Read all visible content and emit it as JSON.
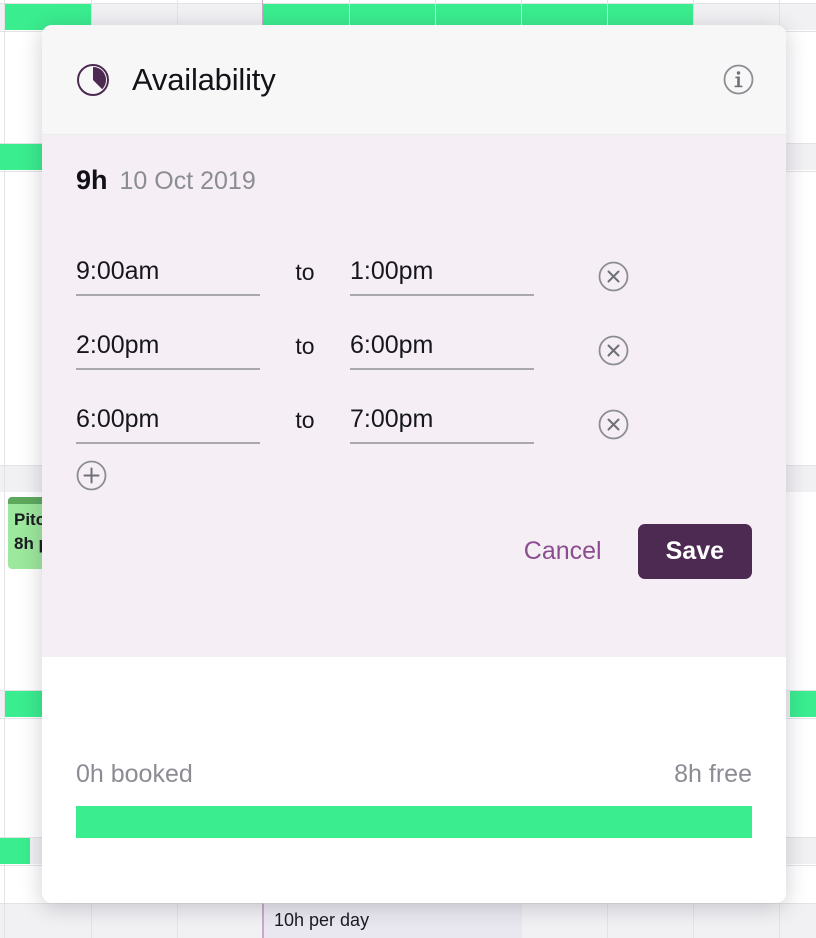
{
  "modal": {
    "title": "Availability",
    "icons": {
      "title_icon": "pie-chart-icon",
      "info_icon": "info-circle-icon",
      "add_icon": "plus-circle-icon",
      "remove_icon": "close-circle-icon"
    },
    "summary": {
      "total_hours": "9h",
      "date": "10 Oct 2019"
    },
    "to_label": "to",
    "slots": [
      {
        "start": "9:00am",
        "end": "1:00pm"
      },
      {
        "start": "2:00pm",
        "end": "6:00pm"
      },
      {
        "start": "6:00pm",
        "end": "7:00pm"
      }
    ],
    "actions": {
      "cancel_label": "Cancel",
      "save_label": "Save"
    },
    "usage": {
      "booked_label": "0h booked",
      "free_label": "8h free",
      "booked_percent": 0,
      "free_percent": 100
    }
  },
  "calendar": {
    "event": {
      "title": "Pitc",
      "subtitle": "8h p"
    },
    "footer_cell": "10h per day"
  },
  "colors": {
    "accent_purple": "#4d2a51",
    "link_purple": "#8a4d8f",
    "free_green": "#3aed8f",
    "event_green": "#9ce89c",
    "event_green_dark": "#5da85d",
    "modal_body": "#f5eff5",
    "modal_header": "#f7f7f7"
  }
}
